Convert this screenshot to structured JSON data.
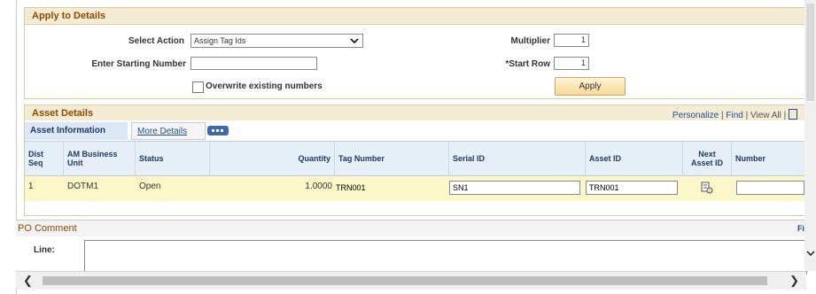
{
  "apply_to_details": {
    "title": "Apply to Details",
    "select_action_label": "Select Action",
    "select_action_value": "Assign Tag Ids",
    "enter_starting_number_label": "Enter Starting Number",
    "enter_starting_number_value": "",
    "overwrite_label": "Overwrite existing numbers",
    "multiplier_label": "Multiplier",
    "multiplier_value": "1",
    "start_row_label": "*Start Row",
    "start_row_value": "1",
    "apply_button": "Apply"
  },
  "asset_details": {
    "title": "Asset Details",
    "nav_personalize": "Personalize",
    "nav_sep1": "|",
    "nav_find": "Find",
    "nav_sep2": "|",
    "nav_view_all": "View All",
    "nav_sep3": "|",
    "tabs": [
      "Asset Information",
      "More Details"
    ],
    "columns": [
      "Dist Seq",
      "AM Business Unit",
      "Status",
      "Quantity",
      "Tag Number",
      "Serial ID",
      "Asset ID",
      "Next Asset ID",
      "Number"
    ],
    "rows": [
      {
        "dist_seq": "1",
        "business_unit": "DOTM1",
        "status": "Open",
        "quantity": "1.0000",
        "tag_number": "TRN001",
        "serial_id": "SN1",
        "asset_id": "TRN001",
        "number": ""
      }
    ]
  },
  "po_comment": {
    "title": "PO Comment",
    "find_link": "Fi",
    "line_label": "Line:"
  },
  "icons": {
    "dropdown": "chevron-down-icon",
    "grid_view": "grid-view-icon",
    "next_asset": "next-asset-icon",
    "scroll_left": "scroll-left-icon",
    "scroll_right": "scroll-right-icon",
    "scroll_down": "scroll-down-icon"
  },
  "colors": {
    "section_title": "#8b4a00",
    "link": "#1d4f91",
    "header_band": "#f4ebd4",
    "grid_header": "#e6eef8",
    "row_highlight": "#fbf7c8"
  }
}
